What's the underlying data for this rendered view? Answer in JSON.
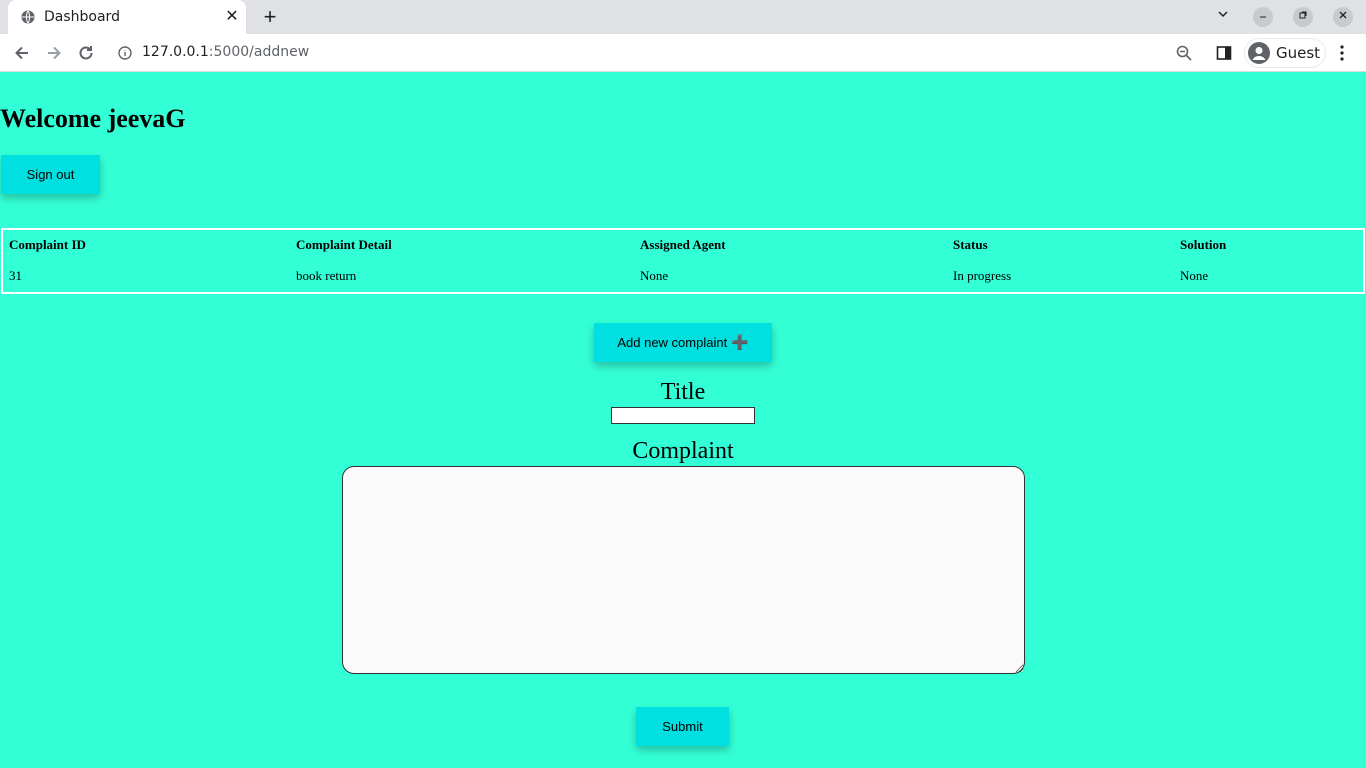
{
  "browser": {
    "tab_title": "Dashboard",
    "new_tab": "+",
    "url_host": "127.0.0.1",
    "url_path": ":5000/addnew",
    "profile_label": "Guest",
    "window_controls": [
      "chevron-down-icon",
      "minimize-icon",
      "restore-icon",
      "close-icon"
    ]
  },
  "page": {
    "welcome": "Welcome jeevaG",
    "sign_out_label": "Sign out",
    "table": {
      "headers": [
        "Complaint ID",
        "Complaint Detail",
        "Assigned Agent",
        "Status",
        "Solution"
      ],
      "rows": [
        [
          "31",
          "book return",
          "None",
          "In progress",
          "None"
        ]
      ]
    },
    "add_new_label": "Add new complaint",
    "add_new_icon": "➕",
    "form": {
      "title_label": "Title",
      "title_value": "",
      "complaint_label": "Complaint",
      "complaint_value": "",
      "submit_label": "Submit"
    }
  },
  "colors": {
    "background": "#33ffd6",
    "button": "#00e0e0"
  }
}
